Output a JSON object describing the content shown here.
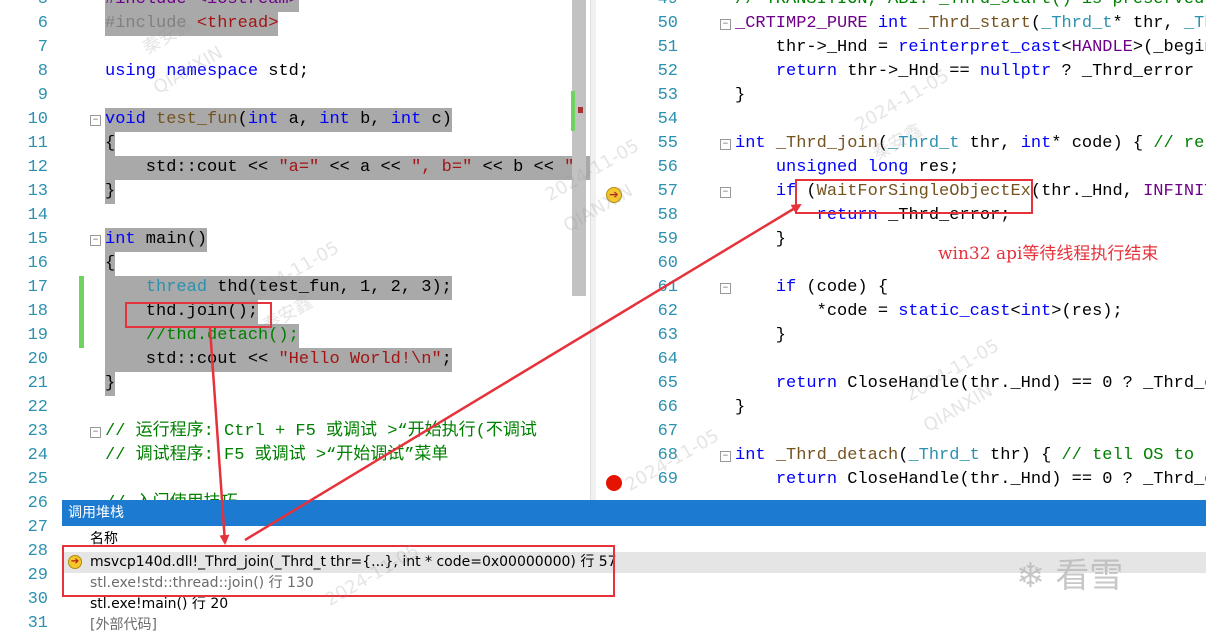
{
  "left_editor": {
    "lines": [
      {
        "n": "5",
        "parts": [
          {
            "t": "#include <iostream>",
            "c": "mac"
          }
        ]
      },
      {
        "n": "6",
        "parts": [
          {
            "t": "#include ",
            "c": "par"
          },
          {
            "t": "<thread>",
            "c": "str"
          }
        ]
      },
      {
        "n": "7",
        "parts": []
      },
      {
        "n": "8",
        "parts": [
          {
            "t": "using",
            "c": "kw"
          },
          {
            "t": " "
          },
          {
            "t": "namespace",
            "c": "kw"
          },
          {
            "t": " std;"
          }
        ]
      },
      {
        "n": "9",
        "parts": []
      },
      {
        "n": "10",
        "parts": [
          {
            "t": "void",
            "c": "kw"
          },
          {
            "t": " "
          },
          {
            "t": "test_fun",
            "c": "fn"
          },
          {
            "t": "("
          },
          {
            "t": "int",
            "c": "kw"
          },
          {
            "t": " a, "
          },
          {
            "t": "int",
            "c": "kw"
          },
          {
            "t": " b, "
          },
          {
            "t": "int",
            "c": "kw"
          },
          {
            "t": " c)"
          }
        ]
      },
      {
        "n": "11",
        "parts": [
          {
            "t": "{"
          }
        ]
      },
      {
        "n": "12",
        "parts": [
          {
            "t": "    std::cout << "
          },
          {
            "t": "\"a=\"",
            "c": "str"
          },
          {
            "t": " << a << "
          },
          {
            "t": "\", b=\"",
            "c": "str"
          },
          {
            "t": " << b << "
          },
          {
            "t": "\", ",
            "c": "str"
          }
        ]
      },
      {
        "n": "13",
        "parts": [
          {
            "t": "}"
          }
        ]
      },
      {
        "n": "14",
        "parts": []
      },
      {
        "n": "15",
        "parts": [
          {
            "t": "int",
            "c": "kw"
          },
          {
            "t": " main()"
          }
        ]
      },
      {
        "n": "16",
        "parts": [
          {
            "t": "{"
          }
        ]
      },
      {
        "n": "17",
        "parts": [
          {
            "t": "    "
          },
          {
            "t": "thread",
            "c": "ty"
          },
          {
            "t": " thd(test_fun, 1, 2, 3);"
          }
        ]
      },
      {
        "n": "18",
        "parts": [
          {
            "t": "    thd.join();"
          }
        ]
      },
      {
        "n": "19",
        "parts": [
          {
            "t": "    "
          },
          {
            "t": "//thd.detach();",
            "c": "cm"
          }
        ]
      },
      {
        "n": "20",
        "parts": [
          {
            "t": "    std::cout << "
          },
          {
            "t": "\"Hello World!\\n\"",
            "c": "str"
          },
          {
            "t": ";"
          }
        ]
      },
      {
        "n": "21",
        "parts": [
          {
            "t": "}"
          }
        ]
      },
      {
        "n": "22",
        "parts": []
      },
      {
        "n": "23",
        "parts": [
          {
            "t": "// 运行程序: Ctrl + F5 或调试 >“开始执行(不调试",
            "c": "cm"
          }
        ]
      },
      {
        "n": "24",
        "parts": [
          {
            "t": "// 调试程序: F5 或调试 >“开始调试”菜单",
            "c": "cm"
          }
        ]
      },
      {
        "n": "25",
        "parts": []
      },
      {
        "n": "26",
        "parts": [
          {
            "t": "// 入门使用技巧",
            "c": "cm"
          }
        ]
      },
      {
        "n": "27",
        "parts": []
      },
      {
        "n": "28",
        "parts": []
      },
      {
        "n": "29",
        "parts": []
      },
      {
        "n": "30",
        "parts": []
      },
      {
        "n": "31",
        "parts": []
      }
    ]
  },
  "right_editor": {
    "lines": [
      {
        "n": "49",
        "parts": [
          {
            "t": "// TRANSITION, ABI: _Thrd_start() is preserved fo",
            "c": "cm"
          }
        ]
      },
      {
        "n": "50",
        "parts": [
          {
            "t": "_CRTIMP2_PURE",
            "c": "mac"
          },
          {
            "t": " "
          },
          {
            "t": "int",
            "c": "kw"
          },
          {
            "t": " "
          },
          {
            "t": "_Thrd_start",
            "c": "fn"
          },
          {
            "t": "("
          },
          {
            "t": "_Thrd_t",
            "c": "ty"
          },
          {
            "t": "* thr, "
          },
          {
            "t": "_Thre",
            "c": "ty"
          }
        ]
      },
      {
        "n": "51",
        "parts": [
          {
            "t": "    thr->_Hnd = "
          },
          {
            "t": "reinterpret_cast",
            "c": "kw"
          },
          {
            "t": "<"
          },
          {
            "t": "HANDLE",
            "c": "mac"
          },
          {
            "t": ">(_begint"
          }
        ]
      },
      {
        "n": "52",
        "parts": [
          {
            "t": "    "
          },
          {
            "t": "return",
            "c": "kw"
          },
          {
            "t": " thr->_Hnd == "
          },
          {
            "t": "nullptr",
            "c": "kw"
          },
          {
            "t": " ? _Thrd_error : _"
          }
        ]
      },
      {
        "n": "53",
        "parts": [
          {
            "t": "}"
          }
        ]
      },
      {
        "n": "54",
        "parts": []
      },
      {
        "n": "55",
        "parts": [
          {
            "t": "int",
            "c": "kw"
          },
          {
            "t": " "
          },
          {
            "t": "_Thrd_join",
            "c": "fn"
          },
          {
            "t": "("
          },
          {
            "t": "_Thrd_t",
            "c": "ty"
          },
          {
            "t": " thr, "
          },
          {
            "t": "int",
            "c": "kw"
          },
          {
            "t": "* code) { "
          },
          {
            "t": "// retur",
            "c": "cm"
          }
        ]
      },
      {
        "n": "56",
        "parts": [
          {
            "t": "    "
          },
          {
            "t": "unsigned",
            "c": "kw"
          },
          {
            "t": " "
          },
          {
            "t": "long",
            "c": "kw"
          },
          {
            "t": " res;"
          }
        ]
      },
      {
        "n": "57",
        "parts": [
          {
            "t": "    "
          },
          {
            "t": "if",
            "c": "kw"
          },
          {
            "t": " ("
          },
          {
            "t": "WaitForSingleObjectEx",
            "c": "fn"
          },
          {
            "t": "(thr._Hnd, "
          },
          {
            "t": "INFINITE",
            "c": "mac"
          },
          {
            "t": ","
          }
        ]
      },
      {
        "n": "58",
        "parts": [
          {
            "t": "        "
          },
          {
            "t": "return",
            "c": "kw"
          },
          {
            "t": " _Thrd_error;"
          }
        ]
      },
      {
        "n": "59",
        "parts": [
          {
            "t": "    }"
          }
        ]
      },
      {
        "n": "60",
        "parts": []
      },
      {
        "n": "61",
        "parts": [
          {
            "t": "    "
          },
          {
            "t": "if",
            "c": "kw"
          },
          {
            "t": " (code) {"
          }
        ]
      },
      {
        "n": "62",
        "parts": [
          {
            "t": "        *code = "
          },
          {
            "t": "static_cast",
            "c": "kw"
          },
          {
            "t": "<"
          },
          {
            "t": "int",
            "c": "kw"
          },
          {
            "t": ">(res);"
          }
        ]
      },
      {
        "n": "63",
        "parts": [
          {
            "t": "    }"
          }
        ]
      },
      {
        "n": "64",
        "parts": []
      },
      {
        "n": "65",
        "parts": [
          {
            "t": "    "
          },
          {
            "t": "return",
            "c": "kw"
          },
          {
            "t": " CloseHandle(thr._Hnd) == 0 ? _Thrd_err"
          }
        ]
      },
      {
        "n": "66",
        "parts": [
          {
            "t": "}"
          }
        ]
      },
      {
        "n": "67",
        "parts": []
      },
      {
        "n": "68",
        "parts": [
          {
            "t": "int",
            "c": "kw"
          },
          {
            "t": " "
          },
          {
            "t": "_Thrd_detach",
            "c": "fn"
          },
          {
            "t": "("
          },
          {
            "t": "_Thrd_t",
            "c": "ty"
          },
          {
            "t": " thr) { "
          },
          {
            "t": "// tell OS to rel",
            "c": "cm"
          }
        ]
      },
      {
        "n": "69",
        "parts": [
          {
            "t": "    "
          },
          {
            "t": "return",
            "c": "kw"
          },
          {
            "t": " CloseHandle(thr._Hnd) == 0 ? _Thrd_err"
          }
        ]
      }
    ],
    "annotation": "win32 api等待线程执行结束"
  },
  "call_stack": {
    "title": "调用堆栈",
    "column_header": "名称",
    "rows": [
      {
        "text": "msvcp140d.dll!_Thrd_join(_Thrd_t thr={...}, int * code=0x00000000) 行 57",
        "state": "active"
      },
      {
        "text": "stl.exe!std::thread::join() 行 130",
        "state": "dim"
      },
      {
        "text": "stl.exe!main() 行 20",
        "state": "normal"
      },
      {
        "text": "[外部代码]",
        "state": "dim"
      }
    ]
  },
  "watermarks": [
    "秦安鑫",
    "QIANXIN",
    "2024-11-05"
  ],
  "logo_text": "看雪",
  "colors": {
    "annotation": "#e5323b",
    "title_bar": "#1c7ad1",
    "breakpoint": "#e51400",
    "arrow": "#f6c82b"
  }
}
